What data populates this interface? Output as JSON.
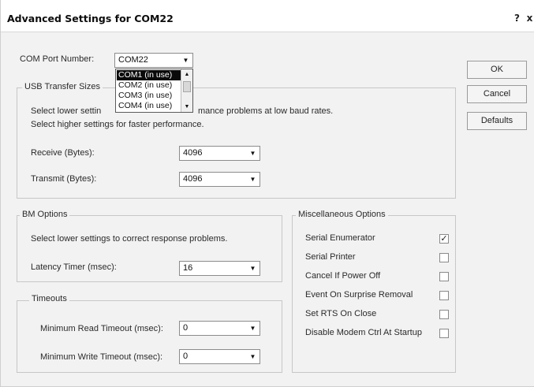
{
  "window": {
    "title": "Advanced Settings for COM22",
    "help_label": "?",
    "close_label": "x"
  },
  "com_port": {
    "label": "COM Port Number:",
    "value": "COM22",
    "options": [
      "COM1 (in use)",
      "COM2 (in use)",
      "COM3 (in use)",
      "COM4 (in use)"
    ],
    "selected_index": 0
  },
  "usb_transfer": {
    "title": "USB Transfer Sizes",
    "hint_line1_left": "Select lower settin",
    "hint_line1_right": "mance problems at low baud rates.",
    "hint_line2": "Select higher settings for faster performance.",
    "receive_label": "Receive (Bytes):",
    "receive_value": "4096",
    "transmit_label": "Transmit (Bytes):",
    "transmit_value": "4096"
  },
  "bm_options": {
    "title": "BM Options",
    "hint": "Select lower settings to correct response problems.",
    "latency_label": "Latency Timer (msec):",
    "latency_value": "16"
  },
  "timeouts": {
    "title": "Timeouts",
    "read_label": "Minimum Read Timeout (msec):",
    "read_value": "0",
    "write_label": "Minimum Write Timeout (msec):",
    "write_value": "0"
  },
  "misc": {
    "title": "Miscellaneous Options",
    "items": [
      {
        "label": "Serial Enumerator",
        "checked": true
      },
      {
        "label": "Serial Printer",
        "checked": false
      },
      {
        "label": "Cancel If Power Off",
        "checked": false
      },
      {
        "label": "Event On Surprise Removal",
        "checked": false
      },
      {
        "label": "Set RTS On Close",
        "checked": false
      },
      {
        "label": "Disable Modem Ctrl At Startup",
        "checked": false
      }
    ]
  },
  "buttons": {
    "ok": "OK",
    "cancel": "Cancel",
    "defaults": "Defaults"
  },
  "icons": {
    "dropdown_arrow": "▼",
    "scroll_up": "▲",
    "scroll_down": "▼",
    "check_mark": "✓"
  }
}
